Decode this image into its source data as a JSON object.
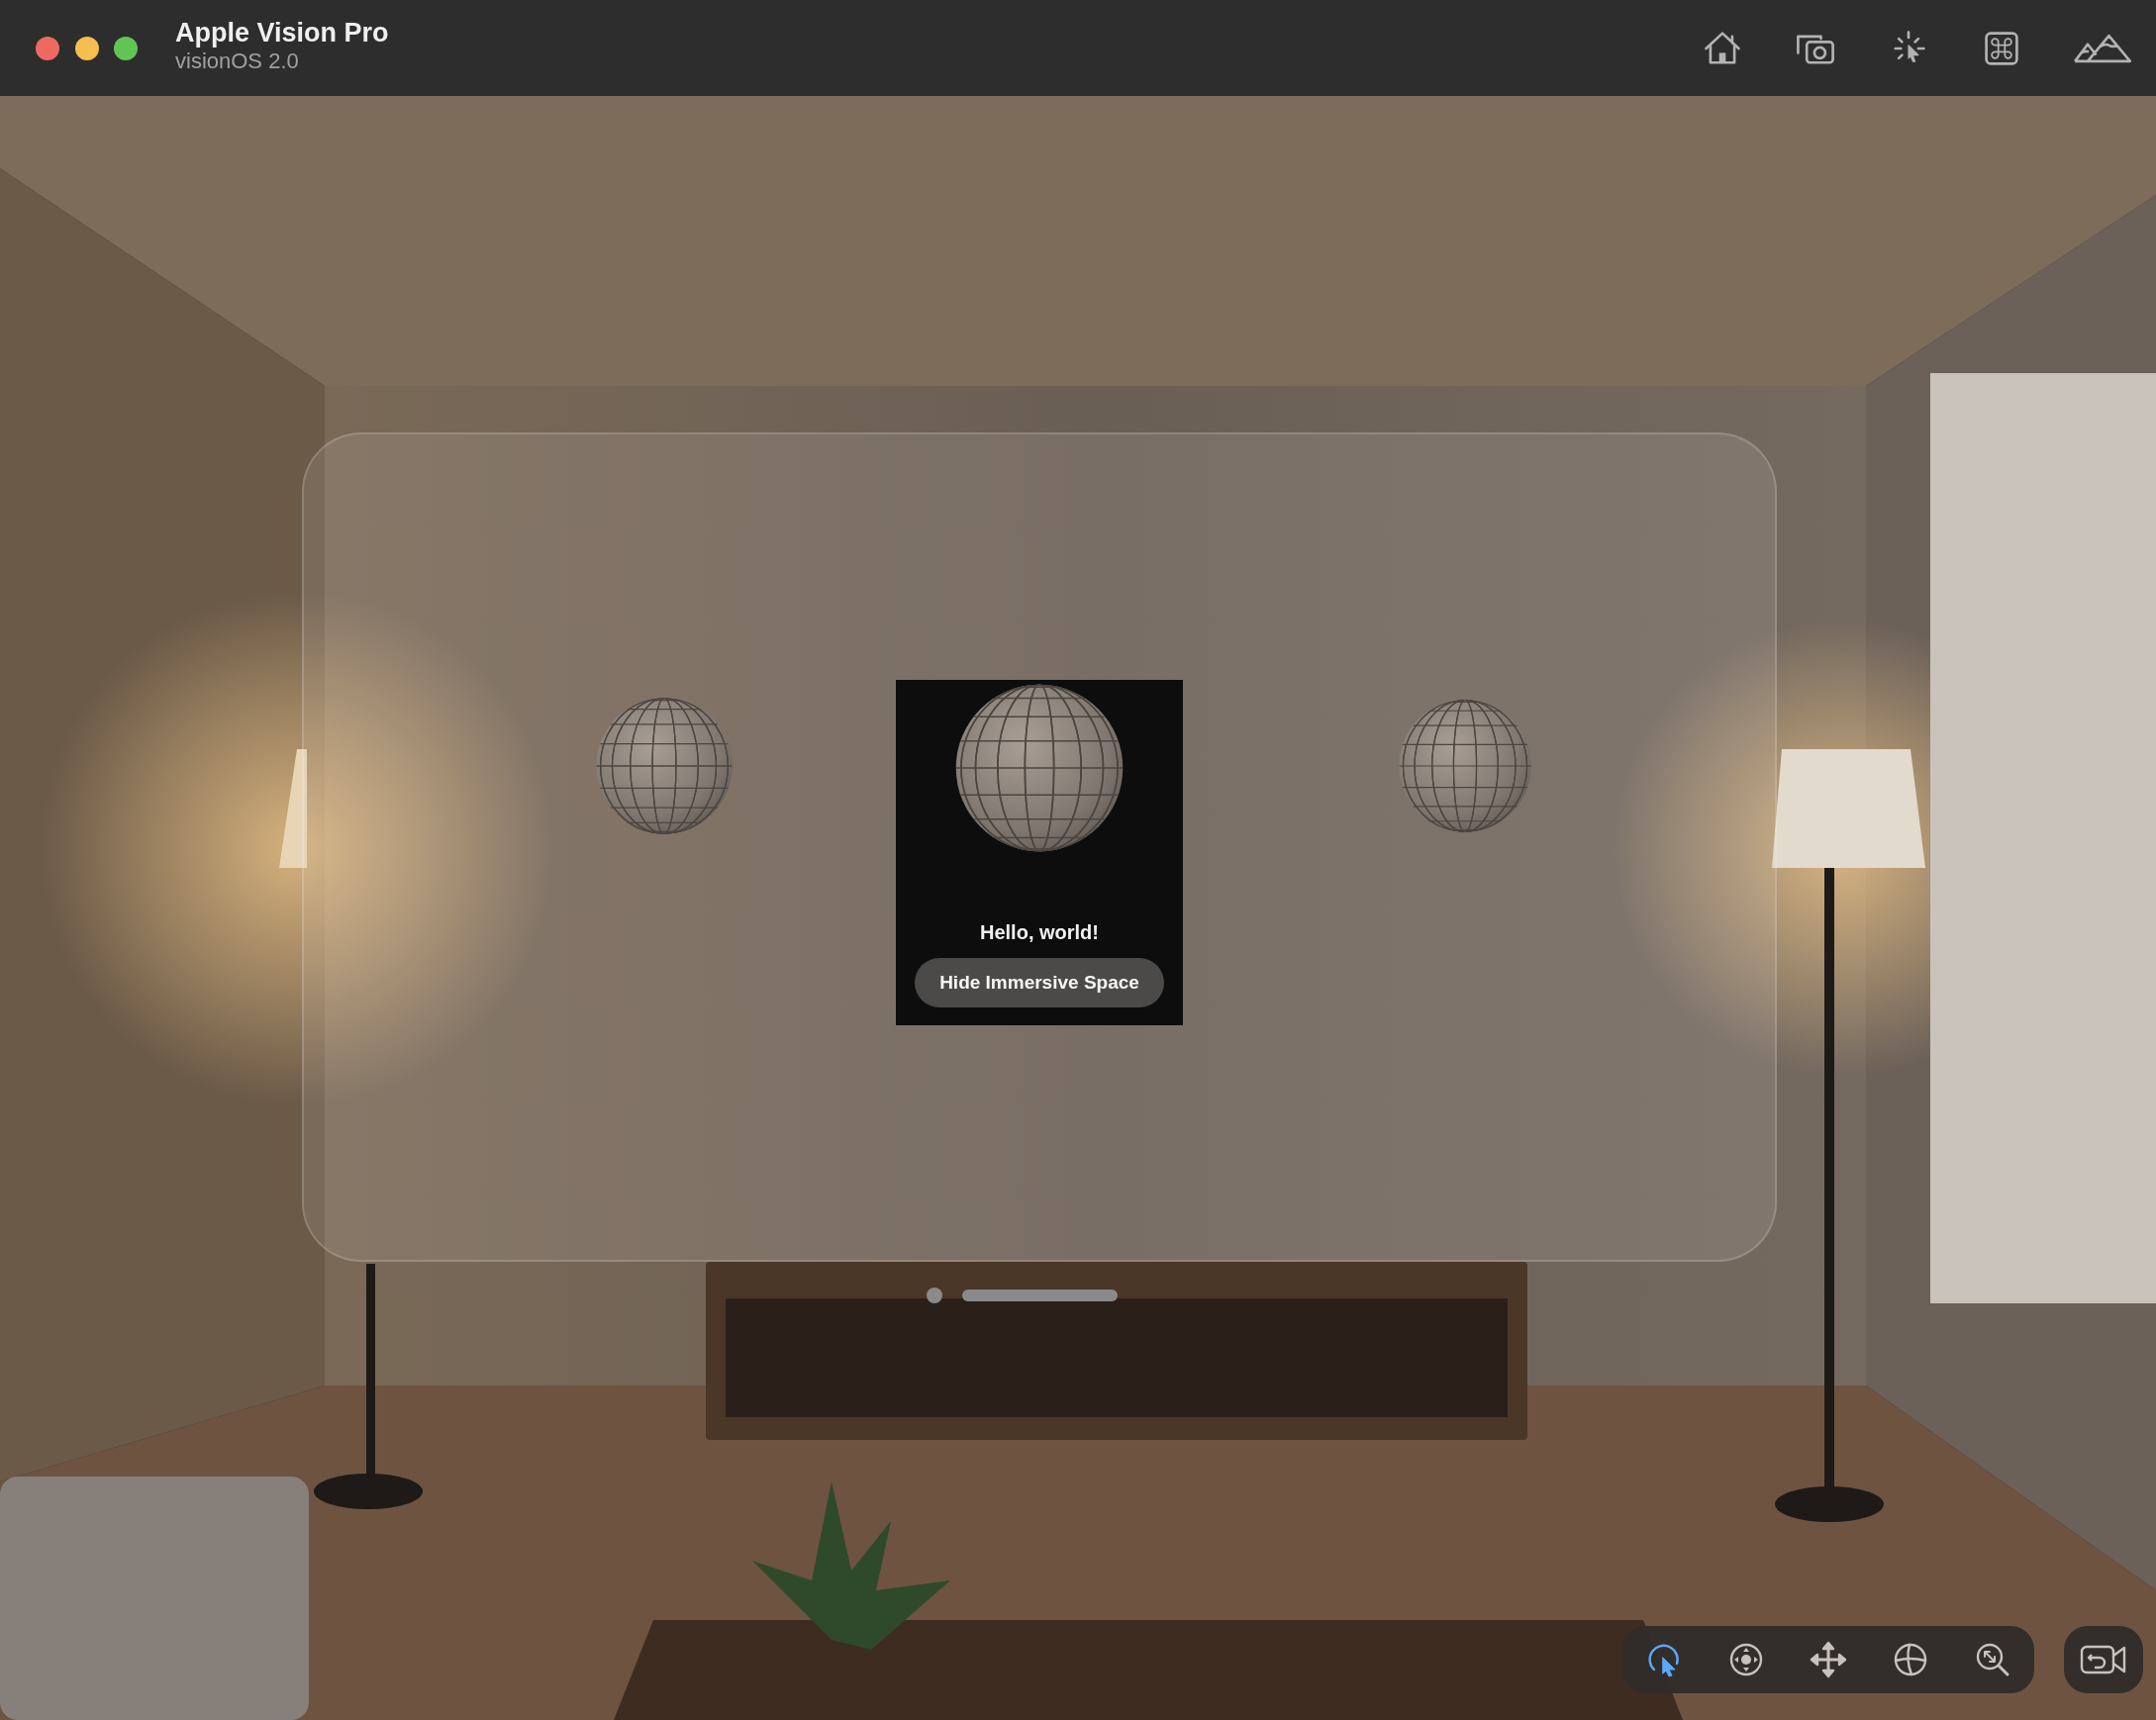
{
  "window": {
    "title": "Apple Vision Pro",
    "subtitle": "visionOS 2.0"
  },
  "app_window": {
    "message": "Hello, world!",
    "button": "Hide Immersive Space"
  },
  "tools": [
    {
      "kind": "select",
      "selected": true
    },
    {
      "kind": "look",
      "selected": false
    },
    {
      "kind": "move",
      "selected": false
    },
    {
      "kind": "orbit",
      "selected": false
    },
    {
      "kind": "zoom",
      "selected": false
    }
  ]
}
